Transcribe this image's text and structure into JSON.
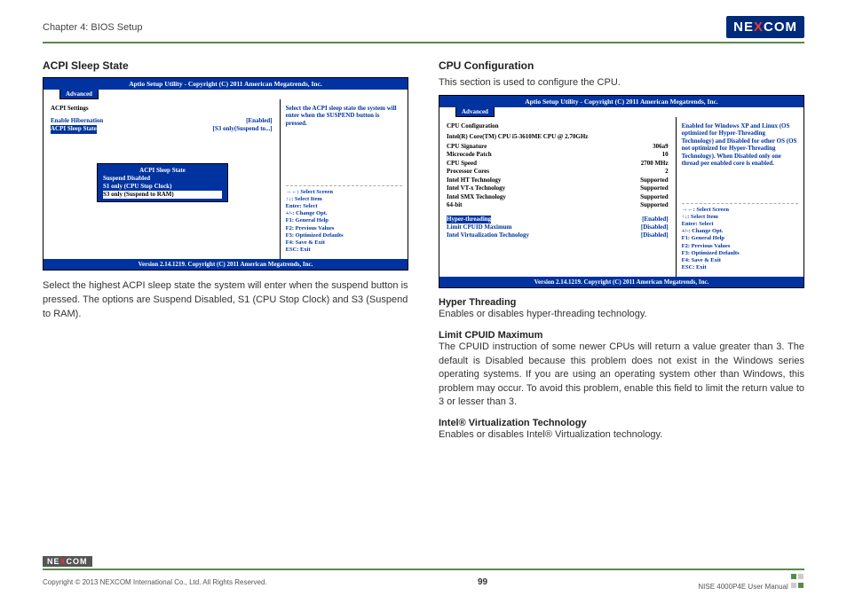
{
  "header": {
    "chapter": "Chapter 4: BIOS Setup",
    "logo1": "NE",
    "logoX": "X",
    "logo2": "COM"
  },
  "left": {
    "title": "ACPI Sleep State",
    "bios": {
      "title": "Aptio Setup Utility - Copyright (C) 2011 American Megatrends, Inc.",
      "tab": "Advanced",
      "heading": "ACPI Settings",
      "rows": [
        {
          "l": "Enable Hibernation",
          "v": "[Enabled]"
        },
        {
          "l": "ACPI Sleep State",
          "v": "[S3 only(Suspend to...]"
        }
      ],
      "popup": {
        "title": "ACPI Sleep State",
        "opts": [
          "Suspend Disabled",
          "S1 only (CPU Stop Clock)"
        ],
        "sel": "S3 only (Suspend to RAM)"
      },
      "help": "Select the ACPI sleep state the system will enter when the SUSPEND button is pressed.",
      "legend": [
        "→←: Select Screen",
        "↑↓: Select Item",
        "Enter: Select",
        "+/-: Change Opt.",
        "F1: General Help",
        "F2: Previous Values",
        "F3: Optimized Defaults",
        "F4: Save & Exit",
        "ESC: Exit"
      ],
      "foot": "Version 2.14.1219. Copyright (C) 2011 American Megatrends, Inc."
    },
    "body": "Select the highest ACPI sleep state the system will enter when the suspend button is pressed. The options are Suspend Disabled, S1 (CPU Stop Clock) and S3 (Suspend to RAM)."
  },
  "right": {
    "title": "CPU Configuration",
    "sub": "This section is used to configure the CPU.",
    "bios": {
      "title": "Aptio Setup Utility - Copyright (C) 2011 American Megatrends, Inc.",
      "tab": "Advanced",
      "heading": "CPU Configuration",
      "info_line": "Intel(R) Core(TM) CPU i5-3610ME CPU @ 2.70GHz",
      "info": [
        {
          "l": "CPU Signature",
          "v": "306a9"
        },
        {
          "l": "Microcode Patch",
          "v": "10"
        },
        {
          "l": "CPU Speed",
          "v": "2700 MHz"
        },
        {
          "l": "Processor Cores",
          "v": "2"
        },
        {
          "l": "Intel HT Technology",
          "v": "Supported"
        },
        {
          "l": "Intel VT-x Technology",
          "v": "Supported"
        },
        {
          "l": "Intel SMX Technology",
          "v": "Supported"
        },
        {
          "l": "64-bit",
          "v": "Supported"
        }
      ],
      "opts": [
        {
          "l": "Hyper-threading",
          "v": "[Enabled]",
          "white": true
        },
        {
          "l": "Limit CPUID Maximum",
          "v": "[Disabled]"
        },
        {
          "l": "Intel Virtualization Technology",
          "v": "[Disabled]"
        }
      ],
      "help": "Enabled for Windows XP and Linux (OS optimized for Hyper-Threading Technology) and Disabled for other OS (OS not optimized for Hyper-Threading Technology). When Disabled only one thread per enabled core is enabled.",
      "legend": [
        "→←: Select Screen",
        "↑↓: Select Item",
        "Enter: Select",
        "+/-: Change Opt.",
        "F1: General Help",
        "F2: Previous Values",
        "F3: Optimized Defaults",
        "F4: Save & Exit",
        "ESC: Exit"
      ],
      "foot": "Version 2.14.1219. Copyright (C) 2011 American Megatrends, Inc."
    },
    "ht_h": "Hyper Threading",
    "ht_p": "Enables or disables hyper-threading technology.",
    "lc_h": "Limit CPUID Maximum",
    "lc_p": "The CPUID instruction of some newer CPUs will return a value greater than 3. The default is Disabled because this problem does not exist in the Windows series operating systems. If you are using an operating system other than Windows, this problem may occur. To avoid this problem, enable this field to limit the return value to 3 or lesser than 3.",
    "vt_h": "Intel® Virtualization Technology",
    "vt_p": "Enables or disables Intel® Virtualization technology."
  },
  "footer": {
    "copyright": "Copyright © 2013 NEXCOM International Co., Ltd. All Rights Reserved.",
    "page": "99",
    "manual": "NISE 4000P4E User Manual"
  }
}
